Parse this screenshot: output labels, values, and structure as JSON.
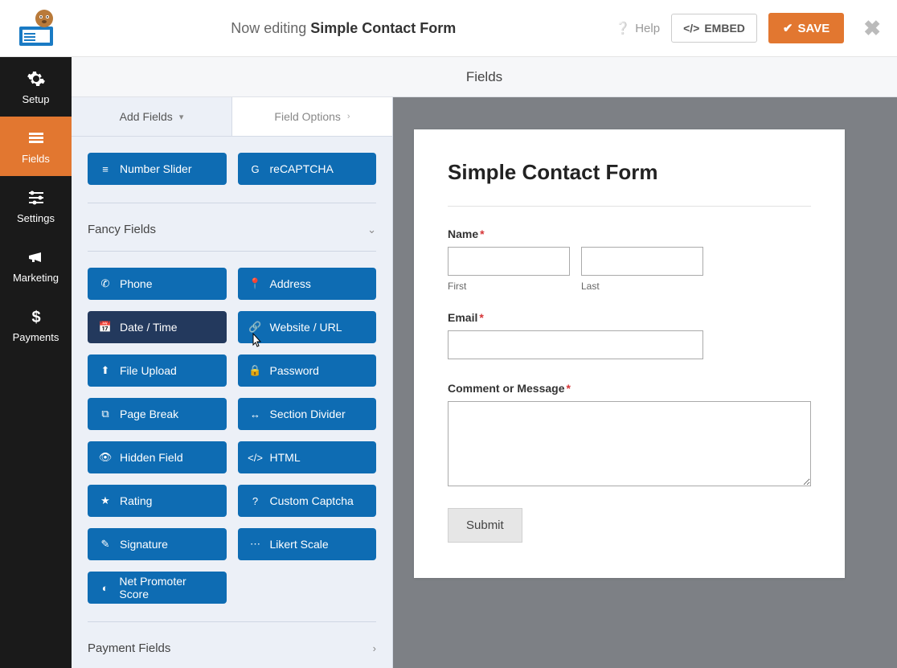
{
  "header": {
    "editing_prefix": "Now editing ",
    "form_name": "Simple Contact Form",
    "help": "Help",
    "embed": "EMBED",
    "save": "SAVE"
  },
  "nav": {
    "setup": "Setup",
    "fields": "Fields",
    "settings": "Settings",
    "marketing": "Marketing",
    "payments": "Payments"
  },
  "fields_header": "Fields",
  "tabs": {
    "add": "Add Fields",
    "options": "Field Options"
  },
  "top_fields": {
    "number_slider": "Number Slider",
    "recaptcha": "reCAPTCHA"
  },
  "fancy_title": "Fancy Fields",
  "fancy": {
    "phone": "Phone",
    "address": "Address",
    "datetime": "Date / Time",
    "website": "Website / URL",
    "fileupload": "File Upload",
    "password": "Password",
    "pagebreak": "Page Break",
    "sectiondivider": "Section Divider",
    "hiddenfield": "Hidden Field",
    "html": "HTML",
    "rating": "Rating",
    "customcaptcha": "Custom Captcha",
    "signature": "Signature",
    "likert": "Likert Scale",
    "nps": "Net Promoter Score"
  },
  "payment_title": "Payment Fields",
  "form": {
    "title": "Simple Contact Form",
    "name_label": "Name",
    "first_sub": "First",
    "last_sub": "Last",
    "email_label": "Email",
    "comment_label": "Comment or Message",
    "submit": "Submit"
  }
}
